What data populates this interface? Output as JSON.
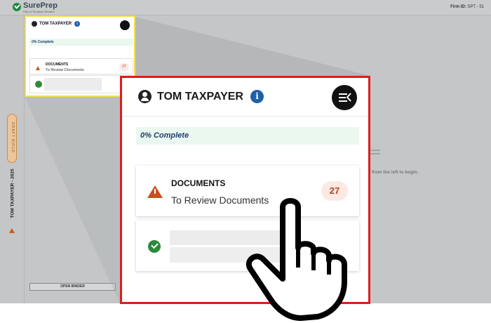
{
  "header": {
    "logo_name": "SurePrep",
    "logo_tagline": "Part of Thomson Reuters",
    "firm_label": "Firm ID:",
    "firm_value": "SPT - 51"
  },
  "left_rail": {
    "status_badge": "DRAFT BUILD",
    "client_title": "TOM TAXPAYER - 2025"
  },
  "open_binder_label": "OPEN BINDER",
  "background_hint": "from the left to begin.",
  "panel": {
    "client_name": "TOM TAXPAYER",
    "info_icon": "i",
    "progress_text": "0% Complete",
    "documents_title": "DOCUMENTS",
    "documents_subtitle": "To Review Documents",
    "documents_count": "27"
  },
  "icons": {
    "menu": "collapse-menu-icon",
    "person": "person-icon",
    "info": "info-icon",
    "warning": "warning-icon",
    "check": "check-circle-icon",
    "pointer": "pointer-hand-icon"
  },
  "colors": {
    "highlight_frame": "#e21b1b",
    "mini_frame": "#f2e04a",
    "warning": "#c8501e",
    "success": "#2a8a3a",
    "info": "#1f5fa8",
    "progress_bg": "#eaf8f0"
  }
}
